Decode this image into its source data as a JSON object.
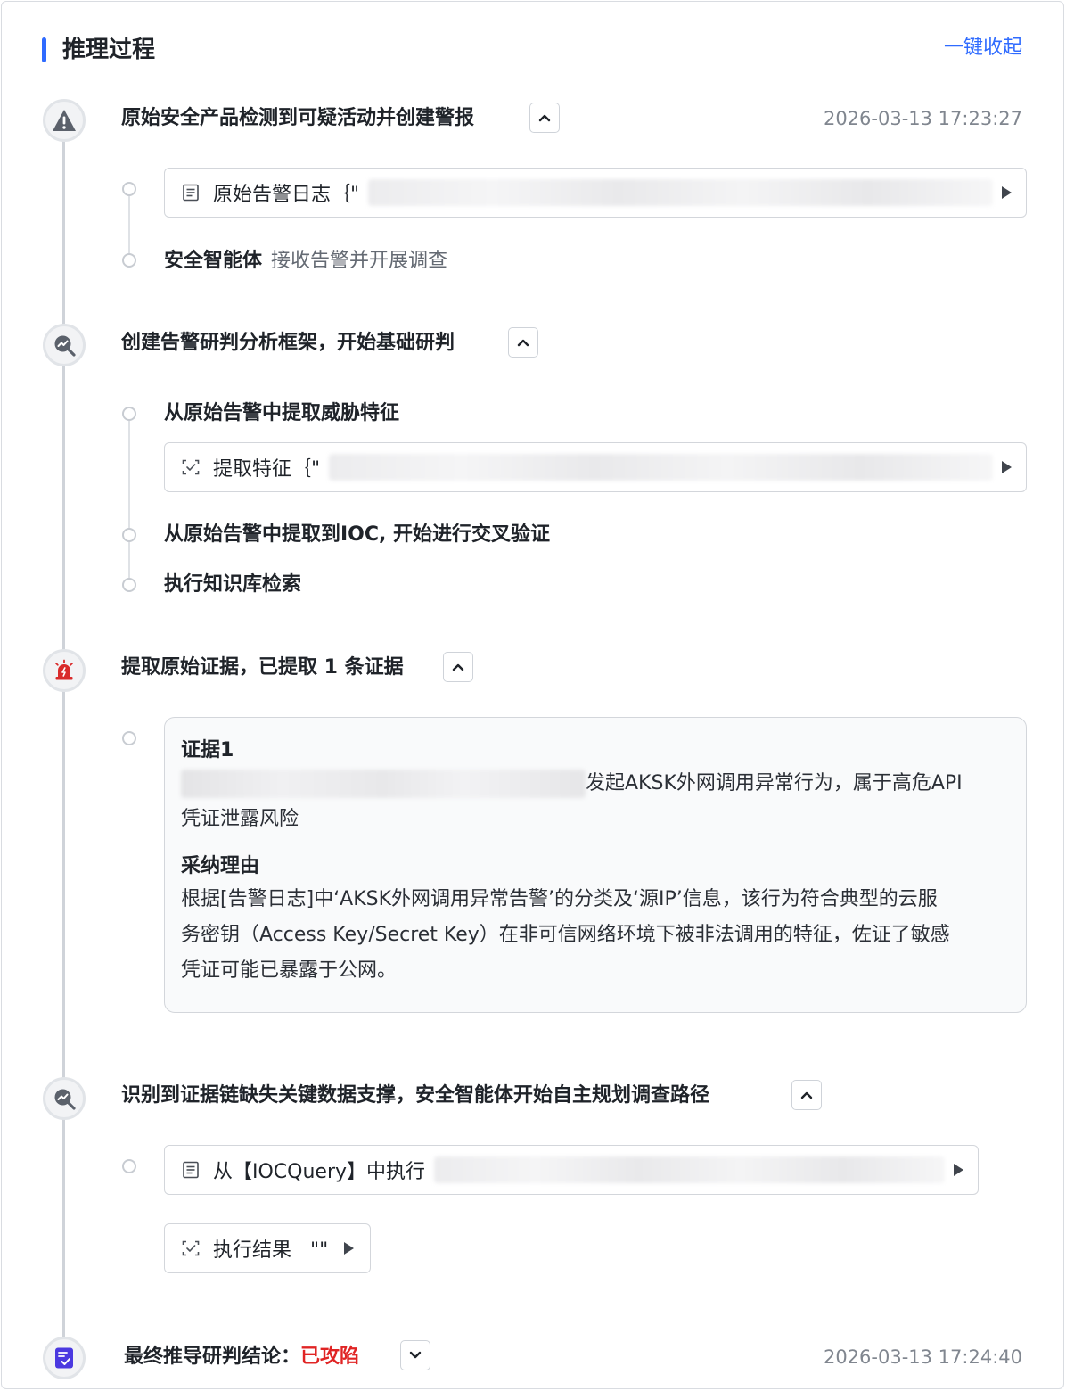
{
  "header": {
    "title": "推理过程",
    "collapse_all": "一键收起",
    "accent_color": "#2f6bff"
  },
  "steps": [
    {
      "title": "原始安全产品检测到可疑活动并创建警报",
      "icon": "warning-icon",
      "timestamp": "2026-03-13 17:23:27",
      "log_label": "原始告警日志｛\"",
      "agent_name": "安全智能体",
      "agent_action": "接收告警并开展调查"
    },
    {
      "title": "创建告警研判分析框架，开始基础研判",
      "icon": "analysis-icon",
      "sub1": "从原始告警中提取威胁特征",
      "feature_label": "提取特征｛\"",
      "sub2": "从原始告警中提取到IOC, 开始进行交叉验证",
      "sub3": "执行知识库检索"
    },
    {
      "title": "提取原始证据，已提取 1 条证据",
      "icon": "alarm-icon",
      "evidence": {
        "heading": "证据1",
        "line1_suffix": "发起AKSK外网调用异常行为，属于高危API",
        "line2": "凭证泄露风险",
        "reason_heading": "采纳理由",
        "reason_1": "根据[告警日志]中‘AKSK外网调用异常告警’的分类及‘源IP’信息，该行为符合典型的云服",
        "reason_2": "务密钥（Access Key/Secret Key）在非可信网络环境下被非法调用的特征，佐证了敏感",
        "reason_3": "凭证可能已暴露于公网。"
      }
    },
    {
      "title": "识别到证据链缺失关键数据支撑，安全智能体开始自主规划调查路径",
      "icon": "analysis-icon",
      "query_label": "从【IOCQuery】中执行",
      "result_label": "执行结果   \"\""
    },
    {
      "title_prefix": "最终推导研判结论：",
      "title_status": "已攻陷",
      "status_color": "#e02424",
      "icon": "checklist-icon",
      "timestamp": "2026-03-13 17:24:40"
    }
  ]
}
